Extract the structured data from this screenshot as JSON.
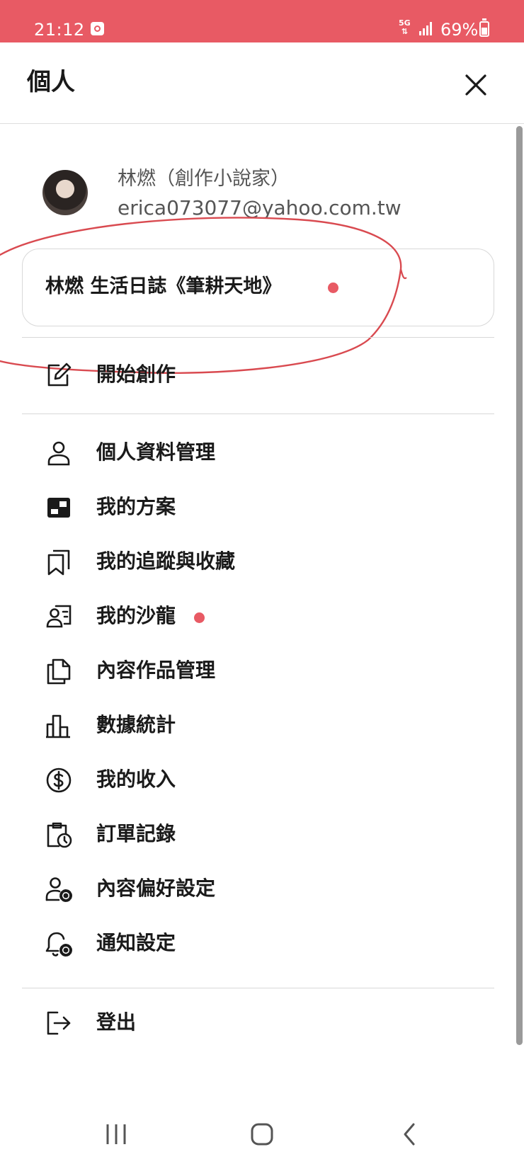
{
  "status_bar": {
    "time": "21:12",
    "network": "5G",
    "battery": "69%",
    "bar_color": "#e85a64"
  },
  "header": {
    "title": "個人",
    "close_icon": "close-icon"
  },
  "profile": {
    "name": "林燃（創作小說家）",
    "email": "erica073077@yahoo.com.tw"
  },
  "blog": {
    "label": "林燃 生活日誌《筆耕天地》",
    "has_notification": true,
    "dot_color": "#e85a64"
  },
  "menu": {
    "create": {
      "label": "開始創作",
      "icon": "edit-icon"
    },
    "items": [
      {
        "label": "個人資料管理",
        "icon": "person-icon"
      },
      {
        "label": "我的方案",
        "icon": "plan-icon"
      },
      {
        "label": "我的追蹤與收藏",
        "icon": "bookmark-icon"
      },
      {
        "label": "我的沙龍",
        "icon": "salon-icon",
        "has_notification": true
      },
      {
        "label": "內容作品管理",
        "icon": "documents-icon"
      },
      {
        "label": "數據統計",
        "icon": "bar-chart-icon"
      },
      {
        "label": "我的收入",
        "icon": "dollar-icon"
      },
      {
        "label": "訂單記錄",
        "icon": "order-history-icon"
      },
      {
        "label": "內容偏好設定",
        "icon": "user-settings-icon"
      },
      {
        "label": "通知設定",
        "icon": "bell-settings-icon"
      }
    ],
    "logout": {
      "label": "登出",
      "icon": "logout-icon"
    }
  },
  "nav_bar": {
    "recent_icon": "recent-apps-icon",
    "home_icon": "home-icon",
    "back_icon": "back-icon"
  }
}
